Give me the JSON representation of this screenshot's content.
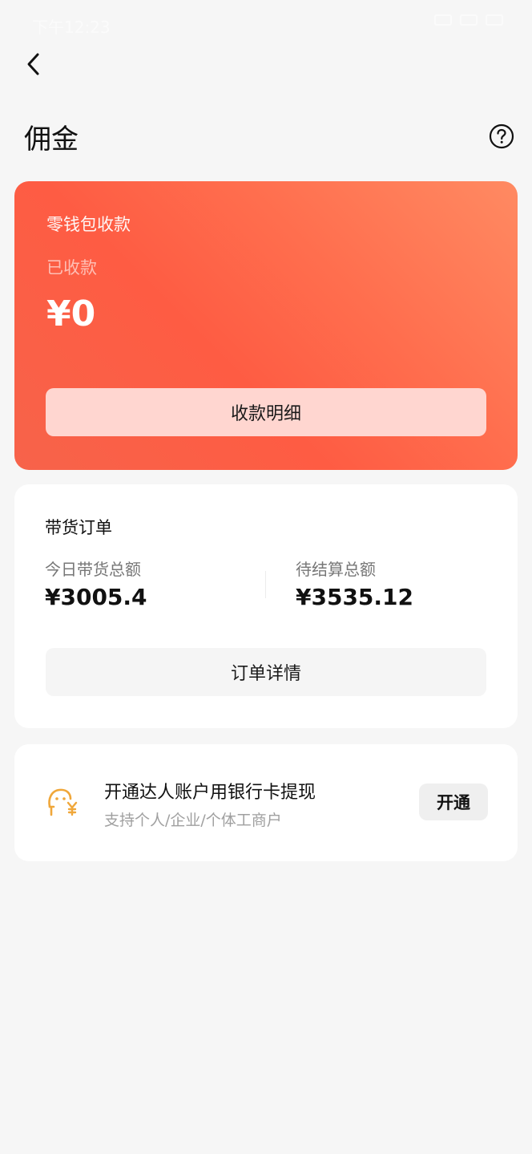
{
  "status_bar": {
    "time": "下午12:23"
  },
  "header": {
    "title": "佣金"
  },
  "wallet": {
    "label": "零钱包收款",
    "sub_label": "已收款",
    "amount": "¥0",
    "detail_button": "收款明细"
  },
  "orders": {
    "title": "带货订单",
    "stats": [
      {
        "label": "今日带货总额",
        "value": "¥3005.4"
      },
      {
        "label": "待结算总额",
        "value": "¥3535.12"
      }
    ],
    "detail_button": "订单详情"
  },
  "bank": {
    "title": "开通达人账户用银行卡提现",
    "subtitle": "支持个人/企业/个体工商户",
    "button": "开通"
  },
  "colors": {
    "background": "#f6f6f6",
    "wallet_gradient_start": "#ff8a62",
    "wallet_gradient_end": "#f7634a",
    "accent_icon": "#f0a73a"
  },
  "icons": {
    "back": "chevron-left-icon",
    "help": "question-circle-icon",
    "bank": "wallet-yen-icon"
  }
}
